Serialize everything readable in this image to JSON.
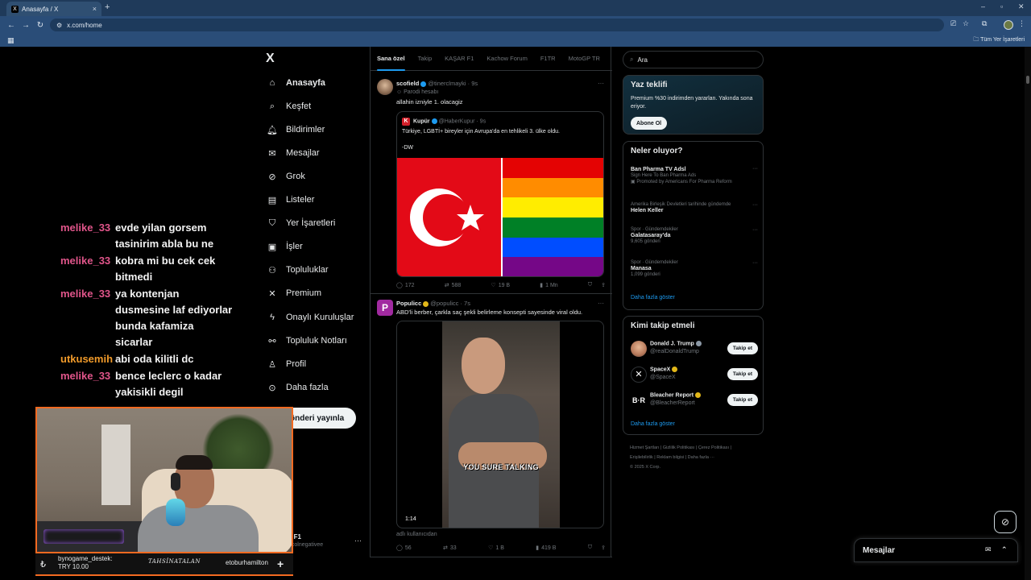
{
  "browser": {
    "tab_title": "Anasayfa / X",
    "tab_favicon": "X",
    "url": "x.com/home",
    "bookmarks_all": "Tüm Yer İşaretleri"
  },
  "nav": {
    "logo": "X",
    "items": [
      {
        "label": "Anasayfa",
        "icon": "home-icon",
        "glyph": "⌂"
      },
      {
        "label": "Keşfet",
        "icon": "search-icon",
        "glyph": "⌕"
      },
      {
        "label": "Bildirimler",
        "icon": "bell-icon",
        "glyph": "🔔︎"
      },
      {
        "label": "Mesajlar",
        "icon": "mail-icon",
        "glyph": "✉"
      },
      {
        "label": "Grok",
        "icon": "grok-icon",
        "glyph": "⊘"
      },
      {
        "label": "Listeler",
        "icon": "list-icon",
        "glyph": "▤"
      },
      {
        "label": "Yer İşaretleri",
        "icon": "bookmark-icon",
        "glyph": "⛉"
      },
      {
        "label": "İşler",
        "icon": "briefcase-icon",
        "glyph": "▣"
      },
      {
        "label": "Topluluklar",
        "icon": "communities-icon",
        "glyph": "⚇"
      },
      {
        "label": "Premium",
        "icon": "x-premium-icon",
        "glyph": "✕"
      },
      {
        "label": "Onaylı Kuruluşlar",
        "icon": "lightning-icon",
        "glyph": "ϟ"
      },
      {
        "label": "Topluluk Notları",
        "icon": "notes-icon",
        "glyph": "⚯"
      },
      {
        "label": "Profil",
        "icon": "profile-icon",
        "glyph": "♙"
      },
      {
        "label": "Daha fazla",
        "icon": "more-circle-icon",
        "glyph": "⊙"
      }
    ],
    "post_button": "önderi yayınla",
    "account_name": "e F1",
    "account_handle": "ecolnegativee"
  },
  "feed": {
    "tabs": [
      "Sana özel",
      "Takip",
      "KAŞAR F1",
      "Kachow Forum",
      "F1TR",
      "MotoGP TR"
    ],
    "tweets": [
      {
        "name": "scofield",
        "handle": "@tinerclmayki · 9s",
        "parody": "Parodi hesabı",
        "text": "allahin izniyle 1. olacagiz",
        "quote": {
          "name": "Kupür",
          "handle": "@HaberKupur · 9s",
          "text": "Türkiye, LGBTİ+ bireyler için Avrupa'da en tehlikeli 3. ülke oldu.",
          "text2": "-DW",
          "avatar_letter": "K"
        },
        "stats": {
          "replies": "172",
          "retweets": "588",
          "likes": "19 B",
          "views": "1 Mn"
        }
      },
      {
        "name": "Populicc",
        "handle": "@populicc · 7s",
        "text": "ABD'li berber, çarkla saç şekli belirleme konsepti sayesinde viral oldu.",
        "video_caption": "YOU SURE TALKING",
        "video_time": "1:14",
        "footer": "adlı kullanıcıdan",
        "stats": {
          "replies": "56",
          "retweets": "33",
          "likes": "1 B",
          "views": "419 B"
        }
      }
    ]
  },
  "right": {
    "search_placeholder": "Ara",
    "premium": {
      "title": "Yaz teklifi",
      "text": "Premium %30 indirimden yararlan. Yakında sona eriyor.",
      "button": "Abone Ol"
    },
    "trends": {
      "title": "Neler oluyor?",
      "items": [
        {
          "meta": "",
          "title": "Ban Pharma TV Adsl",
          "sub": "Sign Here To Ban Pharma Ads",
          "sub2": "Promoted by Americans For Pharma Reform"
        },
        {
          "meta": "Amerika Birleşik Devletleri tarihinde gündemde",
          "title": "Helen Keller",
          "sub": ""
        },
        {
          "meta": "Spor · Gündemdekiler",
          "title": "Galatasaray'da",
          "sub": "9,605 gönderi"
        },
        {
          "meta": "Spor · Gündemdekiler",
          "title": "Manasa",
          "sub": "1,099 gönderi"
        }
      ],
      "show_more": "Daha fazla göster"
    },
    "who_to_follow": {
      "title": "Kimi takip etmeli",
      "items": [
        {
          "name": "Donald J. Trump",
          "handle": "@realDonaldTrump",
          "button": "Takip et"
        },
        {
          "name": "SpaceX",
          "handle": "@SpaceX",
          "button": "Takip et"
        },
        {
          "name": "Bleacher Report",
          "handle": "@BleacherReport",
          "button": "Takip et"
        }
      ],
      "show_more": "Daha fazla göster"
    },
    "footer": [
      "Hizmet Şartları",
      "Gizlilik Politikası",
      "Çerez Politikası",
      "Erişilebilirlik",
      "Reklam bilgisi",
      "Daha fazla ···",
      "© 2025 X Corp."
    ],
    "messages": "Mesajlar"
  },
  "stream": {
    "chat": [
      {
        "user": "melike_33",
        "lines": [
          "evde yilan gorsem",
          "tasinirim abla bu ne"
        ],
        "color": "#e0558a"
      },
      {
        "user": "melike_33",
        "lines": [
          "kobra mi bu cek cek",
          "bitmedi"
        ],
        "color": "#e0558a"
      },
      {
        "user": "melike_33",
        "lines": [
          "ya kontenjan",
          "dusmesine laf ediyorlar",
          "bunda kafamiza",
          "sicarlar"
        ],
        "color": "#e0558a"
      },
      {
        "user": "utkusemih",
        "lines": [
          "abi oda kilitli dc"
        ],
        "color": "#f09a2a"
      },
      {
        "user": "melike_33",
        "lines": [
          "bence leclerc o kadar",
          "yakisikli degil"
        ],
        "color": "#e0558a"
      }
    ],
    "donation_label": "bynogame_destek:",
    "donation_amount": "TRY 10.00",
    "signature": "TAHSİNATALAN",
    "next_user": "etoburhamilton",
    "webcam_border": "#f36a21"
  }
}
